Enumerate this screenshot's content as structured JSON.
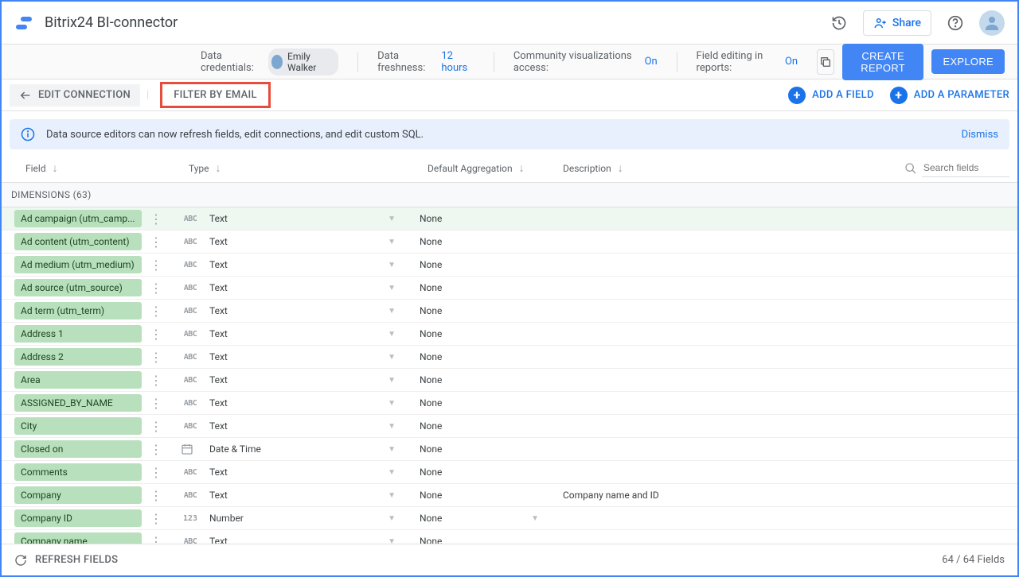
{
  "header": {
    "title": "Bitrix24 BI-connector",
    "share": "Share"
  },
  "subheader": {
    "credentials_label": "Data credentials:",
    "credentials_value": "Emily Walker",
    "freshness_label": "Data freshness:",
    "freshness_value": "12 hours",
    "viz_label": "Community visualizations access:",
    "viz_value": "On",
    "fieldedit_label": "Field editing in reports:",
    "fieldedit_value": "On",
    "create_report": "CREATE REPORT",
    "explore": "EXPLORE"
  },
  "toolbar": {
    "edit_connection": "EDIT CONNECTION",
    "filter_by_email": "FILTER BY EMAIL",
    "add_field": "ADD A FIELD",
    "add_parameter": "ADD A PARAMETER"
  },
  "banner": {
    "text": "Data source editors can now refresh fields, edit connections, and edit custom SQL.",
    "dismiss": "Dismiss"
  },
  "columns": {
    "field": "Field",
    "type": "Type",
    "agg": "Default Aggregation",
    "desc": "Description",
    "search_placeholder": "Search fields"
  },
  "section": {
    "dimensions_label": "DIMENSIONS (63)"
  },
  "type_labels": {
    "text": "Text",
    "datetime": "Date & Time",
    "number": "Number"
  },
  "agg_labels": {
    "none": "None"
  },
  "rows": [
    {
      "name": "Ad campaign (utm_camp...",
      "type": "text",
      "agg": "none",
      "desc": "",
      "agg_dd": false,
      "hovered": true
    },
    {
      "name": "Ad content (utm_content)",
      "type": "text",
      "agg": "none",
      "desc": "",
      "agg_dd": false
    },
    {
      "name": "Ad medium (utm_medium)",
      "type": "text",
      "agg": "none",
      "desc": "",
      "agg_dd": false
    },
    {
      "name": "Ad source (utm_source)",
      "type": "text",
      "agg": "none",
      "desc": "",
      "agg_dd": false
    },
    {
      "name": "Ad term (utm_term)",
      "type": "text",
      "agg": "none",
      "desc": "",
      "agg_dd": false
    },
    {
      "name": "Address 1",
      "type": "text",
      "agg": "none",
      "desc": "",
      "agg_dd": false
    },
    {
      "name": "Address 2",
      "type": "text",
      "agg": "none",
      "desc": "",
      "agg_dd": false
    },
    {
      "name": "Area",
      "type": "text",
      "agg": "none",
      "desc": "",
      "agg_dd": false
    },
    {
      "name": "ASSIGNED_BY_NAME",
      "type": "text",
      "agg": "none",
      "desc": "",
      "agg_dd": false
    },
    {
      "name": "City",
      "type": "text",
      "agg": "none",
      "desc": "",
      "agg_dd": false
    },
    {
      "name": "Closed on",
      "type": "datetime",
      "agg": "none",
      "desc": "",
      "agg_dd": false
    },
    {
      "name": "Comments",
      "type": "text",
      "agg": "none",
      "desc": "",
      "agg_dd": false
    },
    {
      "name": "Company",
      "type": "text",
      "agg": "none",
      "desc": "Company name and ID",
      "agg_dd": false
    },
    {
      "name": "Company ID",
      "type": "number",
      "agg": "none",
      "desc": "",
      "agg_dd": true
    },
    {
      "name": "Company name",
      "type": "text",
      "agg": "none",
      "desc": "",
      "agg_dd": false
    }
  ],
  "footer": {
    "refresh": "REFRESH FIELDS",
    "count": "64 / 64 Fields"
  }
}
